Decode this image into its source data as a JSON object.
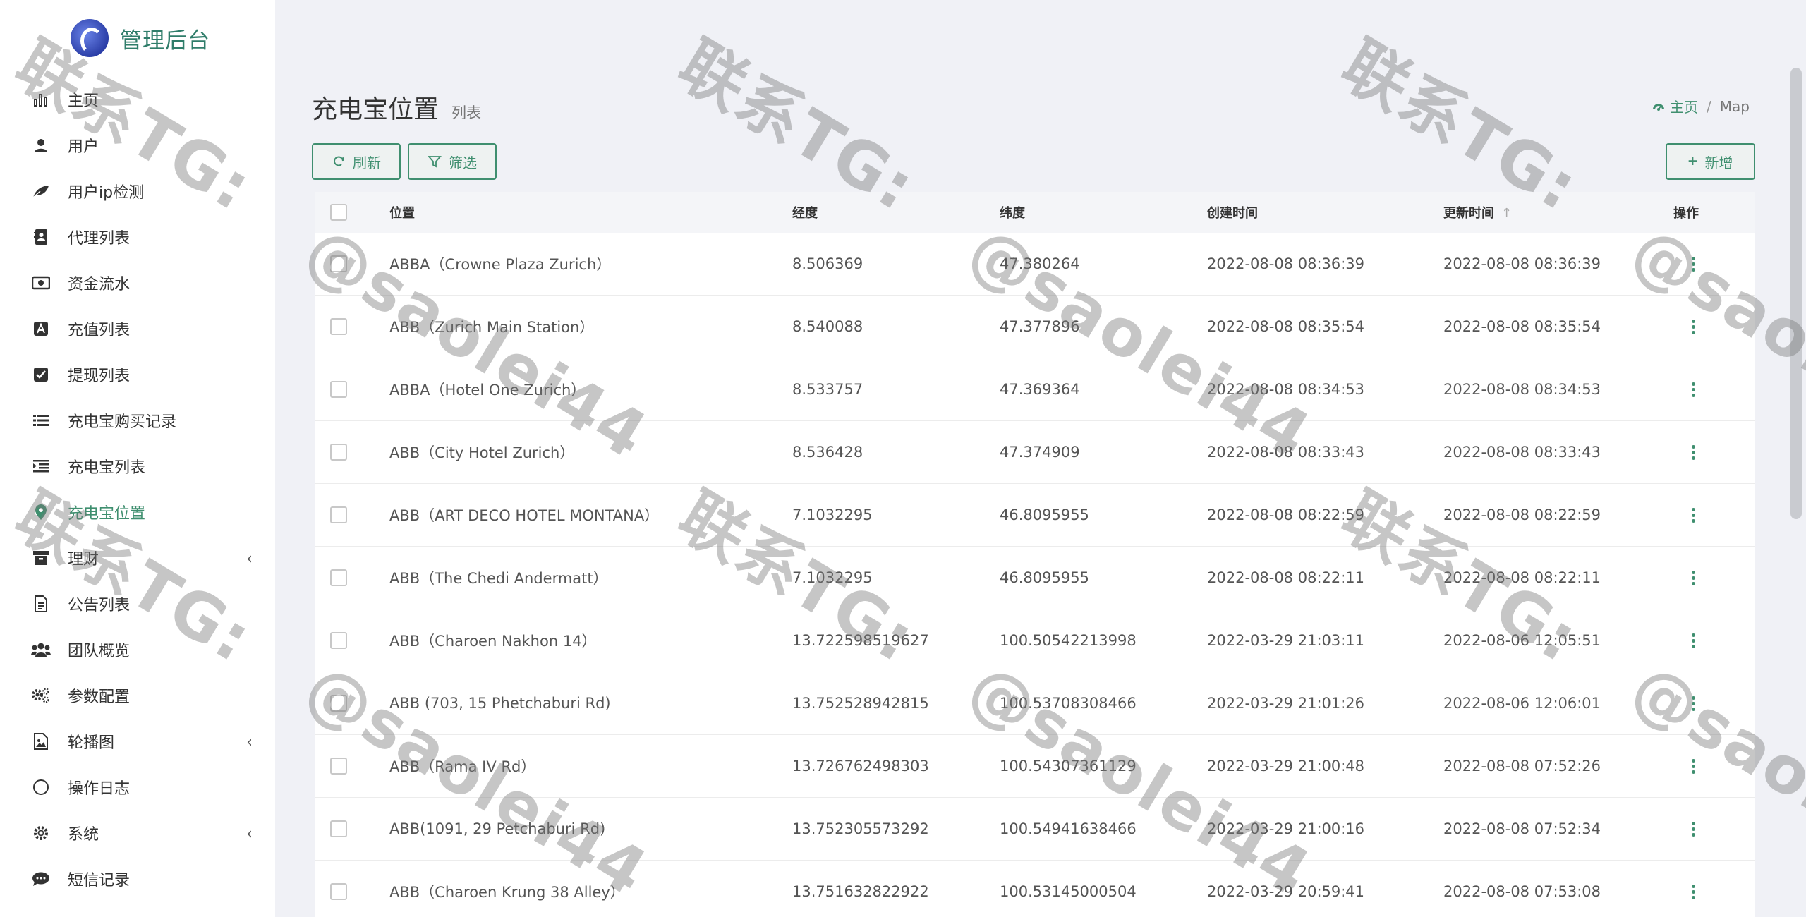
{
  "app": {
    "title": "管理后台"
  },
  "sidebar": {
    "items": [
      {
        "label": "主页",
        "icon": "bar-chart-icon",
        "active": false,
        "expandable": false
      },
      {
        "label": "用户",
        "icon": "user-icon",
        "active": false,
        "expandable": false
      },
      {
        "label": "用户ip检测",
        "icon": "leaf-icon",
        "active": false,
        "expandable": false
      },
      {
        "label": "代理列表",
        "icon": "contact-book-icon",
        "active": false,
        "expandable": false
      },
      {
        "label": "资金流水",
        "icon": "money-icon",
        "active": false,
        "expandable": false
      },
      {
        "label": "充值列表",
        "icon": "account-box-icon",
        "active": false,
        "expandable": false
      },
      {
        "label": "提现列表",
        "icon": "check-square-icon",
        "active": false,
        "expandable": false
      },
      {
        "label": "充电宝购买记录",
        "icon": "list-icon",
        "active": false,
        "expandable": false
      },
      {
        "label": "充电宝列表",
        "icon": "indent-list-icon",
        "active": false,
        "expandable": false
      },
      {
        "label": "充电宝位置",
        "icon": "map-pin-icon",
        "active": true,
        "expandable": false
      },
      {
        "label": "理财",
        "icon": "archive-icon",
        "active": false,
        "expandable": true
      },
      {
        "label": "公告列表",
        "icon": "document-icon",
        "active": false,
        "expandable": false
      },
      {
        "label": "团队概览",
        "icon": "users-icon",
        "active": false,
        "expandable": false
      },
      {
        "label": "参数配置",
        "icon": "gears-icon",
        "active": false,
        "expandable": false
      },
      {
        "label": "轮播图",
        "icon": "image-icon",
        "active": false,
        "expandable": true
      },
      {
        "label": "操作日志",
        "icon": "circle-icon",
        "active": false,
        "expandable": false
      },
      {
        "label": "系统",
        "icon": "gear-icon",
        "active": false,
        "expandable": true
      },
      {
        "label": "短信记录",
        "icon": "chat-icon",
        "active": false,
        "expandable": false
      }
    ]
  },
  "header": {
    "title": "充电宝位置",
    "subtitle": "列表",
    "breadcrumb": {
      "home": "主页",
      "current": "Map"
    }
  },
  "toolbar": {
    "refresh": "刷新",
    "filter": "筛选",
    "add": "新增"
  },
  "table": {
    "columns": {
      "location": "位置",
      "lng": "经度",
      "lat": "纬度",
      "created": "创建时间",
      "updated": "更新时间",
      "actions": "操作"
    },
    "rows": [
      {
        "location": "ABBA（Crowne Plaza Zurich）",
        "lng": "8.506369",
        "lat": "47.380264",
        "created": "2022-08-08 08:36:39",
        "updated": "2022-08-08 08:36:39"
      },
      {
        "location": "ABB（Zurich Main Station）",
        "lng": "8.540088",
        "lat": "47.377896",
        "created": "2022-08-08 08:35:54",
        "updated": "2022-08-08 08:35:54"
      },
      {
        "location": "ABBA（Hotel One Zurich）",
        "lng": "8.533757",
        "lat": "47.369364",
        "created": "2022-08-08 08:34:53",
        "updated": "2022-08-08 08:34:53"
      },
      {
        "location": "ABB（City Hotel Zurich）",
        "lng": "8.536428",
        "lat": "47.374909",
        "created": "2022-08-08 08:33:43",
        "updated": "2022-08-08 08:33:43"
      },
      {
        "location": "ABB（ART DECO HOTEL MONTANA）",
        "lng": "7.1032295",
        "lat": "46.8095955",
        "created": "2022-08-08 08:22:59",
        "updated": "2022-08-08 08:22:59"
      },
      {
        "location": "ABB（The Chedi Andermatt）",
        "lng": "7.1032295",
        "lat": "46.8095955",
        "created": "2022-08-08 08:22:11",
        "updated": "2022-08-08 08:22:11"
      },
      {
        "location": "ABB（Charoen Nakhon 14）",
        "lng": "13.722598519627",
        "lat": "100.50542213998",
        "created": "2022-03-29 21:03:11",
        "updated": "2022-08-06 12:05:51"
      },
      {
        "location": "ABB (703, 15 Phetchaburi Rd)",
        "lng": "13.752528942815",
        "lat": "100.53708308466",
        "created": "2022-03-29 21:01:26",
        "updated": "2022-08-06 12:06:01"
      },
      {
        "location": "ABB（Rama IV Rd）",
        "lng": "13.726762498303",
        "lat": "100.54307361129",
        "created": "2022-03-29 21:00:48",
        "updated": "2022-08-08 07:52:26"
      },
      {
        "location": "ABB(1091, 29 Petchaburi Rd)",
        "lng": "13.752305573292",
        "lat": "100.54941638466",
        "created": "2022-03-29 21:00:16",
        "updated": "2022-08-08 07:52:34"
      },
      {
        "location": "ABB（Charoen Krung 38 Alley）",
        "lng": "13.751632822922",
        "lat": "100.53145000504",
        "created": "2022-03-29 20:59:41",
        "updated": "2022-08-08 07:53:08"
      }
    ]
  },
  "watermark": {
    "line1": "联系TG:",
    "line2": "@saolei44"
  },
  "colors": {
    "accent": "#3f8f6f",
    "sidebar_bg": "#ffffff",
    "page_bg": "#f0f1f6"
  }
}
